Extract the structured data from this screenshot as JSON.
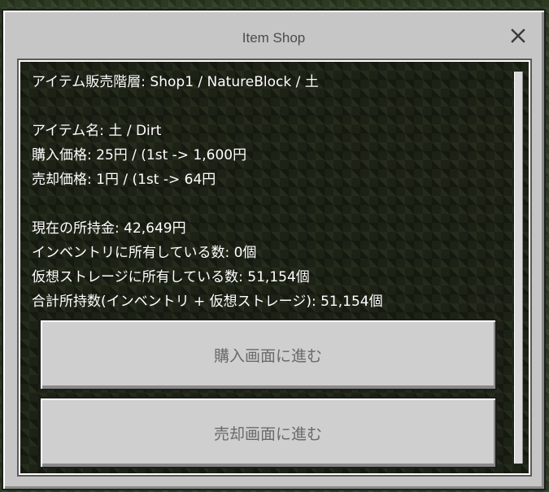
{
  "dialog": {
    "title": "Item Shop",
    "close_icon": "close-icon"
  },
  "info": {
    "hierarchy": "アイテム販売階層: Shop1 / NatureBlock / 土",
    "item_name": "アイテム名: 土 / Dirt",
    "buy_price": "購入価格: 25円 / (1st -> 1,600円",
    "sell_price": "売却価格: 1円 / (1st -> 64円",
    "money": "現在の所持金: 42,649円",
    "inventory_count": "インベントリに所有している数: 0個",
    "virtual_count": "仮想ストレージに所有している数: 51,154個",
    "total_count": "合計所持数(インベントリ + 仮想ストレージ): 51,154個"
  },
  "buttons": {
    "buy": "購入画面に進む",
    "sell": "売却画面に進む"
  }
}
